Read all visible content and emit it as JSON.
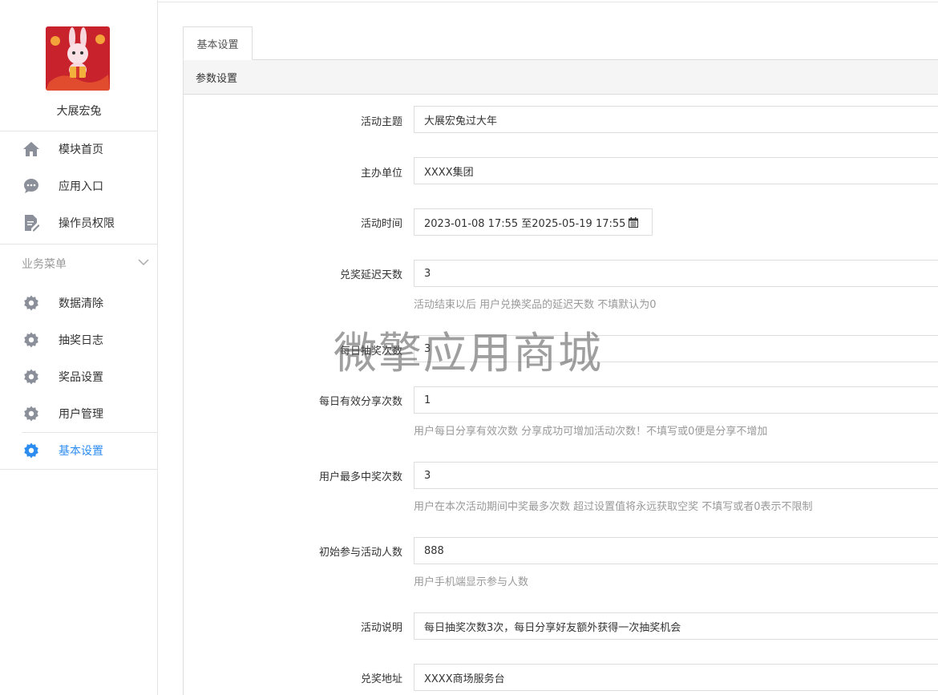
{
  "sidebar": {
    "profile_name": "大展宏兔",
    "top_items": [
      {
        "label": "模块首页",
        "icon": "home-icon"
      },
      {
        "label": "应用入口",
        "icon": "chat-bubble-icon"
      },
      {
        "label": "操作员权限",
        "icon": "document-edit-icon"
      }
    ],
    "section_title": "业务菜单",
    "business_items": [
      {
        "label": "数据清除",
        "icon": "gear-icon"
      },
      {
        "label": "抽奖日志",
        "icon": "gear-icon"
      },
      {
        "label": "奖品设置",
        "icon": "gear-icon"
      },
      {
        "label": "用户管理",
        "icon": "gear-icon"
      },
      {
        "label": "基本设置",
        "icon": "gear-icon",
        "active": true
      }
    ],
    "active_color": "#2d8cf0"
  },
  "tab": {
    "label": "基本设置"
  },
  "panel": {
    "title": "参数设置"
  },
  "form": {
    "theme": {
      "label": "活动主题",
      "value": "大展宏兔过大年"
    },
    "organizer": {
      "label": "主办单位",
      "value": "XXXX集团"
    },
    "time": {
      "label": "活动时间",
      "value": "2023-01-08 17:55 至2025-05-19 17:55"
    },
    "delay_days": {
      "label": "兑奖延迟天数",
      "value": "3",
      "help": "活动结束以后 用户兑换奖品的延迟天数 不填默认为0"
    },
    "daily_draws": {
      "label": "每日抽奖次数",
      "value": "3"
    },
    "daily_shares": {
      "label": "每日有效分享次数",
      "value": "1",
      "help": "用户每日分享有效次数 分享成功可增加活动次数！不填写或0便是分享不增加"
    },
    "max_wins": {
      "label": "用户最多中奖次数",
      "value": "3",
      "help": "用户在本次活动期间中奖最多次数 超过设置值将永远获取空奖 不填写或者0表示不限制"
    },
    "initial_participants": {
      "label": "初始参与活动人数",
      "value": "888",
      "help": "用户手机端显示参与人数"
    },
    "description": {
      "label": "活动说明",
      "value": "每日抽奖次数3次，每日分享好友额外获得一次抽奖机会"
    },
    "redeem_address": {
      "label": "兑奖地址",
      "value": "XXXX商场服务台"
    }
  },
  "watermark": "微擎应用商城"
}
